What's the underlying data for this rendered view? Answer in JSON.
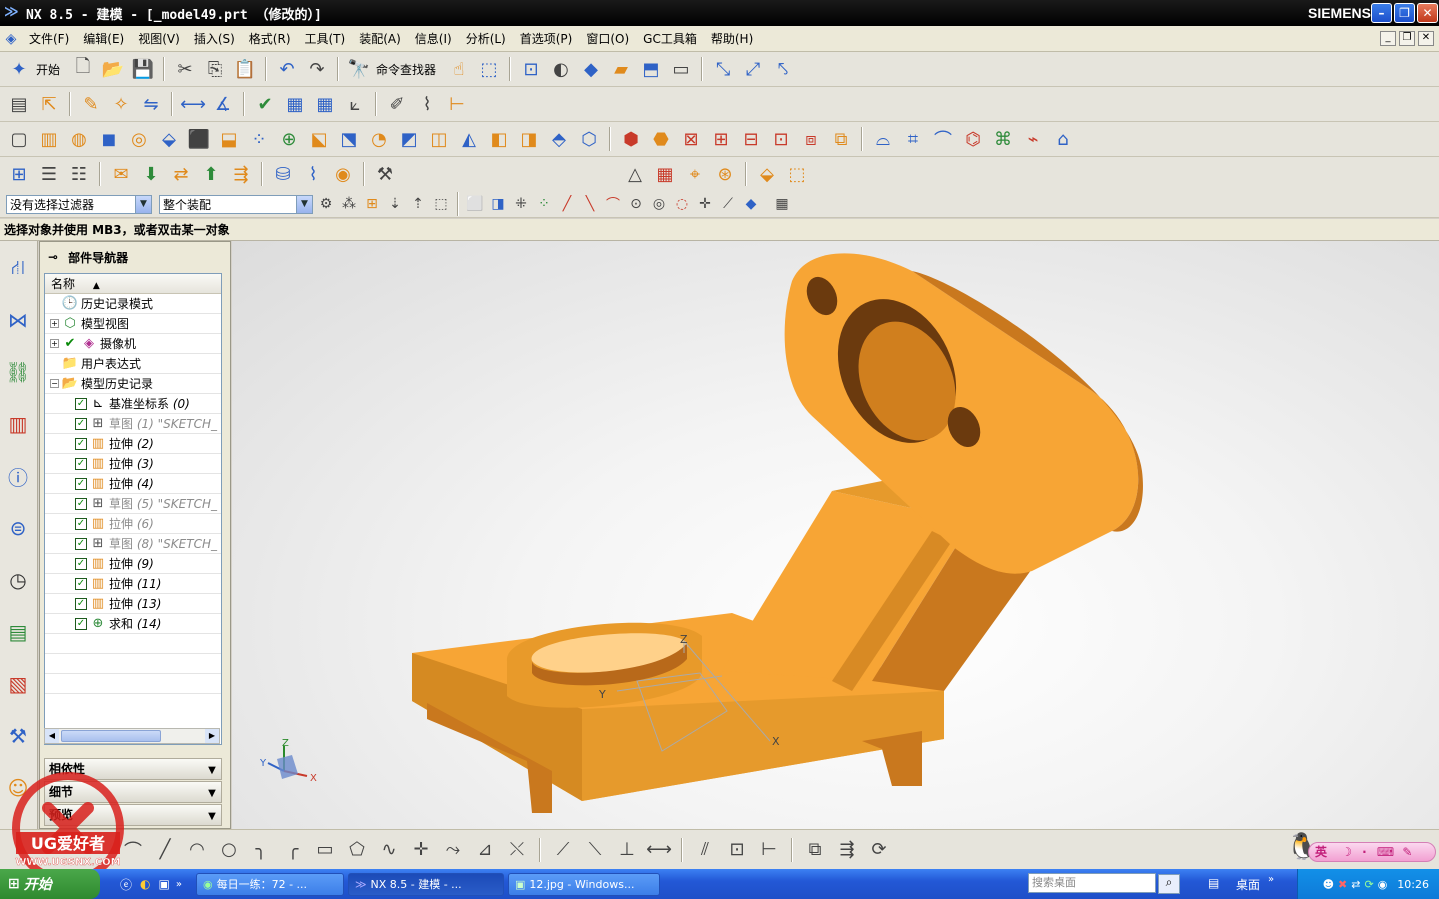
{
  "window": {
    "title": "NX 8.5 - 建模 - [_model49.prt （修改的）]",
    "brand": "SIEMENS"
  },
  "menu": [
    "文件(F)",
    "编辑(E)",
    "视图(V)",
    "插入(S)",
    "格式(R)",
    "工具(T)",
    "装配(A)",
    "信息(I)",
    "分析(L)",
    "首选项(P)",
    "窗口(O)",
    "GC工具箱",
    "帮助(H)"
  ],
  "toolbar": {
    "start_label": "开始",
    "command_finder_label": "命令查找器"
  },
  "selection": {
    "filter_value": "没有选择过滤器",
    "scope_value": "整个装配"
  },
  "status": {
    "prompt": "选择对象并使用 MB3，或者双击某一对象"
  },
  "navigator": {
    "title": "部件导航器",
    "column_header": "名称",
    "nodes": [
      {
        "label": "历史记录模式"
      },
      {
        "label": "模型视图"
      },
      {
        "label": "摄像机"
      },
      {
        "label": "用户表达式"
      },
      {
        "label": "模型历史记录"
      }
    ],
    "features": [
      {
        "name": "基准坐标系",
        "num": "(0)"
      },
      {
        "name": "草图",
        "num": "(1) \"SKETCH_"
      },
      {
        "name": "拉伸",
        "num": "(2)"
      },
      {
        "name": "拉伸",
        "num": "(3)"
      },
      {
        "name": "拉伸",
        "num": "(4)"
      },
      {
        "name": "草图",
        "num": "(5) \"SKETCH_"
      },
      {
        "name": "拉伸",
        "num": "(6)"
      },
      {
        "name": "草图",
        "num": "(8) \"SKETCH_"
      },
      {
        "name": "拉伸",
        "num": "(9)"
      },
      {
        "name": "拉伸",
        "num": "(11)"
      },
      {
        "name": "拉伸",
        "num": "(13)"
      },
      {
        "name": "求和",
        "num": "(14)"
      }
    ],
    "panels": [
      "相依性",
      "细节",
      "预览"
    ]
  },
  "viewport": {
    "triad_x": "X",
    "triad_y": "Y",
    "triad_z": "Z",
    "csys_x": "X",
    "csys_y": "Y",
    "csys_z": "Z"
  },
  "logo": {
    "text": "UG爱好者",
    "url": "WWW.UGSNX.COM"
  },
  "ime": {
    "label": "英"
  },
  "taskbar": {
    "start": "开始",
    "tasks": [
      "每日一练：72 - ...",
      "NX 8.5 - 建模 - ...",
      "12.jpg - Windows..."
    ],
    "search_placeholder": "搜索桌面",
    "desktop_label": "桌面",
    "clock": "10:26"
  },
  "colors": {
    "part_orange": "#f7a535",
    "part_shadow": "#c9781e",
    "title_bg": "#000000"
  }
}
